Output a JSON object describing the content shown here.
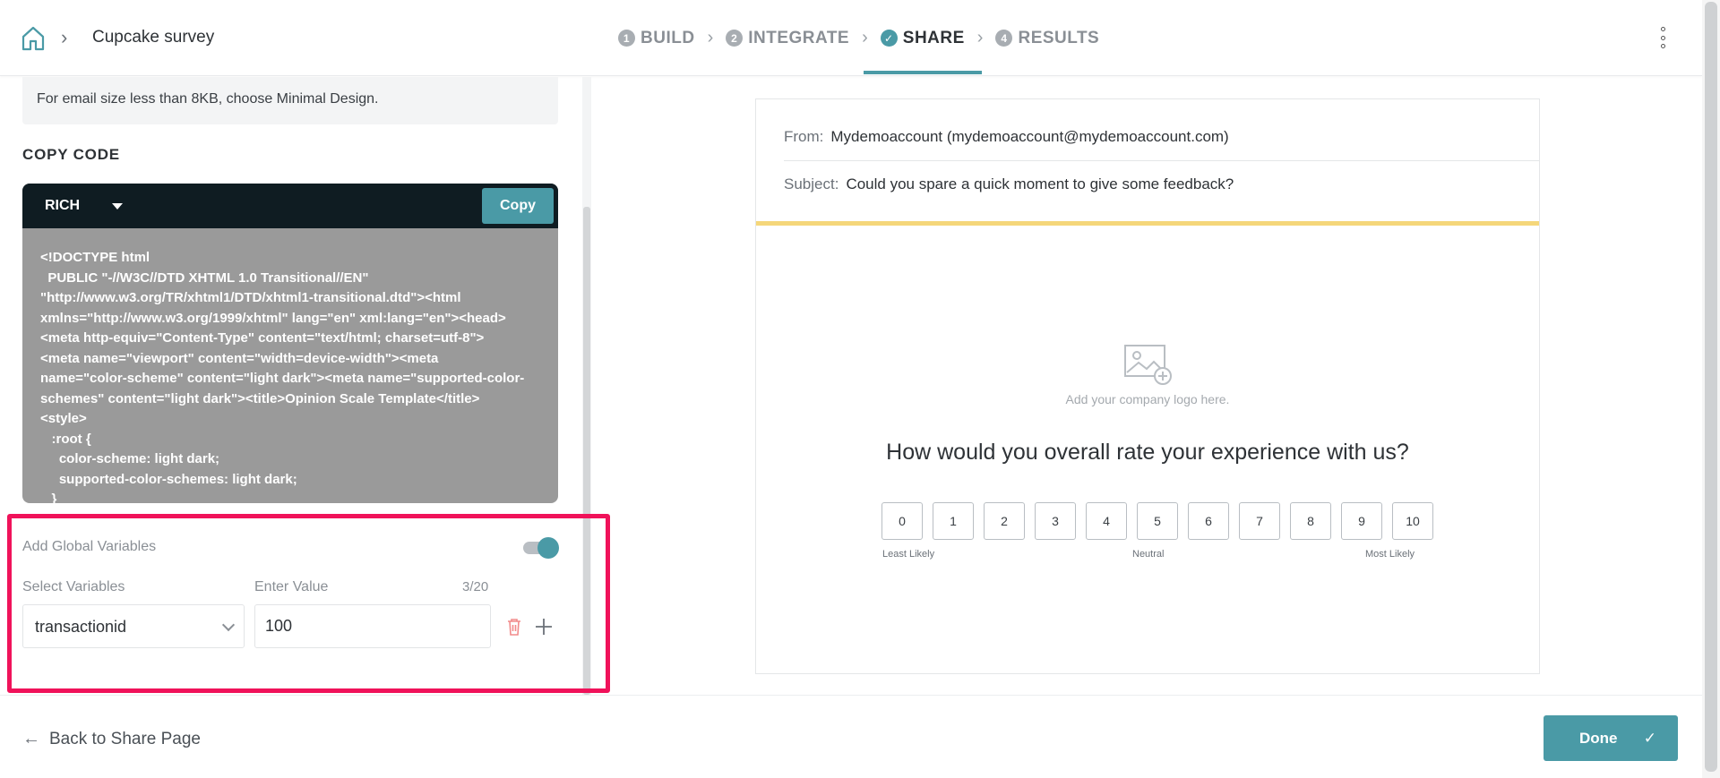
{
  "header": {
    "breadcrumb_title": "Cupcake survey",
    "steps": [
      {
        "num": "1",
        "label": "BUILD"
      },
      {
        "num": "2",
        "label": "INTEGRATE"
      },
      {
        "num": "✓",
        "label": "SHARE"
      },
      {
        "num": "4",
        "label": "RESULTS"
      }
    ]
  },
  "left": {
    "info_text": "For email size less than 8KB, choose Minimal Design.",
    "section_title": "COPY CODE",
    "code_type": "RICH",
    "copy_label": "Copy",
    "code": "<!DOCTYPE html\n  PUBLIC \"-//W3C//DTD XHTML 1.0 Transitional//EN\"\n\"http://www.w3.org/TR/xhtml1/DTD/xhtml1-transitional.dtd\"><html\nxmlns=\"http://www.w3.org/1999/xhtml\" lang=\"en\" xml:lang=\"en\"><head>\n<meta http-equiv=\"Content-Type\" content=\"text/html; charset=utf-8\">\n<meta name=\"viewport\" content=\"width=device-width\"><meta\nname=\"color-scheme\" content=\"light dark\"><meta name=\"supported-color-\nschemes\" content=\"light dark\"><title>Opinion Scale Template</title>\n<style>\n   :root {\n     color-scheme: light dark;\n     supported-color-schemes: light dark;\n   }",
    "global_vars_label": "Add Global Variables",
    "select_label": "Select Variables",
    "value_label": "Enter Value",
    "char_count": "3/20",
    "selected_variable": "transactionid",
    "value": "100"
  },
  "preview": {
    "from_key": "From:",
    "from_value": "Mydemoaccount (mydemoaccount@mydemoaccount.com)",
    "subject_key": "Subject:",
    "subject_value": "Could you spare a quick moment to give some feedback?",
    "logo_text": "Add your company logo here.",
    "question": "How would you overall rate your experience with us?",
    "scale": [
      "0",
      "1",
      "2",
      "3",
      "4",
      "5",
      "6",
      "7",
      "8",
      "9",
      "10"
    ],
    "label_low": "Least Likely",
    "label_mid": "Neutral",
    "label_high": "Most Likely"
  },
  "footer": {
    "back_label": "Back to Share Page",
    "done_label": "Done"
  },
  "colors": {
    "accent": "#4a9aa6",
    "highlight": "#f0125a",
    "code_header": "#0f1c22",
    "preview_bar": "#f5d77a"
  }
}
